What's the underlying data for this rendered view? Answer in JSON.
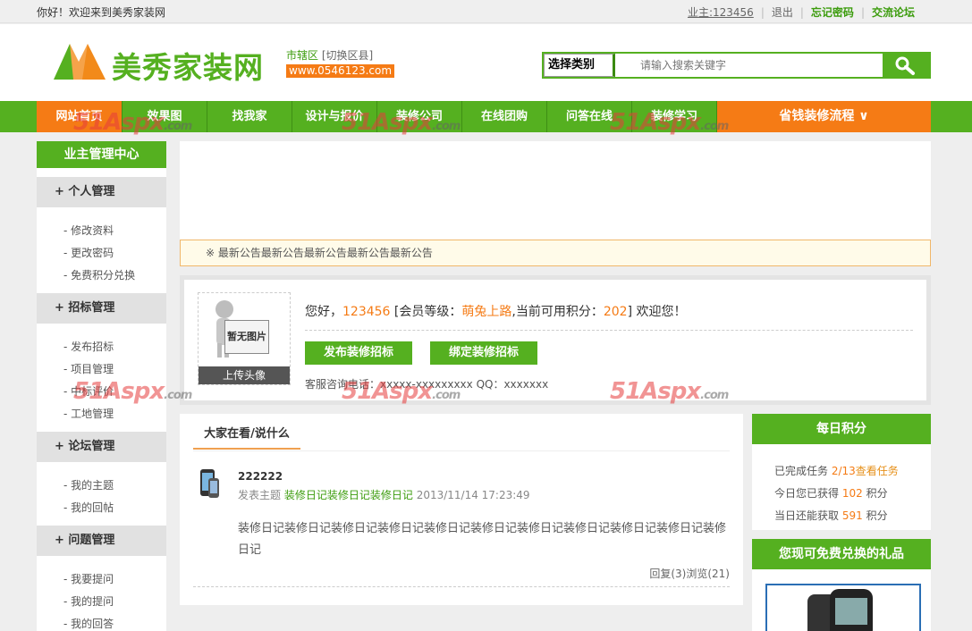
{
  "topbar": {
    "welcome": "你好！欢迎来到美秀家装网",
    "user": "业主:123456",
    "logout": "退出",
    "forgot": "忘记密码",
    "forum": "交流论坛"
  },
  "header": {
    "logo": "美秀家装网",
    "region": "市辖区",
    "region_switch": "[切换区县]",
    "domain": "www.0546123.com",
    "search_category": "选择类别",
    "search_placeholder": "请输入搜索关键字",
    "search_button_icon": "search-icon"
  },
  "nav": {
    "items": [
      "网站首页",
      "效果图",
      "找我家",
      "设计与报价",
      "装修公司",
      "在线团购",
      "问答在线",
      "装修学习"
    ],
    "process": "省钱装修流程 ∨"
  },
  "watermark": {
    "text": "51Aspx",
    "suffix": ".com"
  },
  "sidebar": {
    "title": "业主管理中心",
    "groups": [
      {
        "label": "+ 个人管理",
        "links": [
          "- 修改资料",
          "- 更改密码",
          "- 免费积分兑换"
        ]
      },
      {
        "label": "+ 招标管理",
        "links": [
          "- 发布招标",
          "- 项目管理",
          "- 中标评价",
          "- 工地管理"
        ]
      },
      {
        "label": "+ 论坛管理",
        "links": [
          "- 我的主题",
          "- 我的回帖"
        ]
      },
      {
        "label": "+ 问题管理",
        "links": [
          "- 我要提问",
          "- 我的提问",
          "- 我的回答"
        ]
      }
    ]
  },
  "notice": "※ 最新公告最新公告最新公告最新公告最新公告",
  "profile": {
    "avatar_placeholder": "暂无图片",
    "upload": "上传头像",
    "greet_prefix": "您好，",
    "username": "123456",
    "level_prefix": " [会员等级：",
    "level": "萌兔上路",
    "points_prefix": ",当前可用积分：",
    "points": "202",
    "greet_suffix": "] 欢迎您！",
    "btn_publish": "发布装修招标",
    "btn_bind": "绑定装修招标",
    "service": "客服咨询电话：xxxxx-xxxxxxxxx QQ：xxxxxxx"
  },
  "feed": {
    "tab": "大家在看/说什么",
    "post_user": "222222",
    "post_prefix": "发表主题",
    "post_title": "装修日记装修日记装修日记",
    "post_time": "2013/11/14 17:23:49",
    "post_body": "装修日记装修日记装修日记装修日记装修日记装修日记装修日记装修日记装修日记装修日记装修日记",
    "post_stats": "回复(3)浏览(21)"
  },
  "points_box": {
    "title": "每日积分",
    "done_label": "已完成任务",
    "done_value": "2/13",
    "view_tasks": "查看任务",
    "today_label": "今日您已获得",
    "today_value": "102",
    "remaining_label": "当日还能获取",
    "remaining_value": "591",
    "unit": "积分"
  },
  "gifts_box": {
    "title": "您现可免费兑换的礼品"
  },
  "colors": {
    "brand_green": "#55b020",
    "accent_orange": "#f57b15"
  }
}
